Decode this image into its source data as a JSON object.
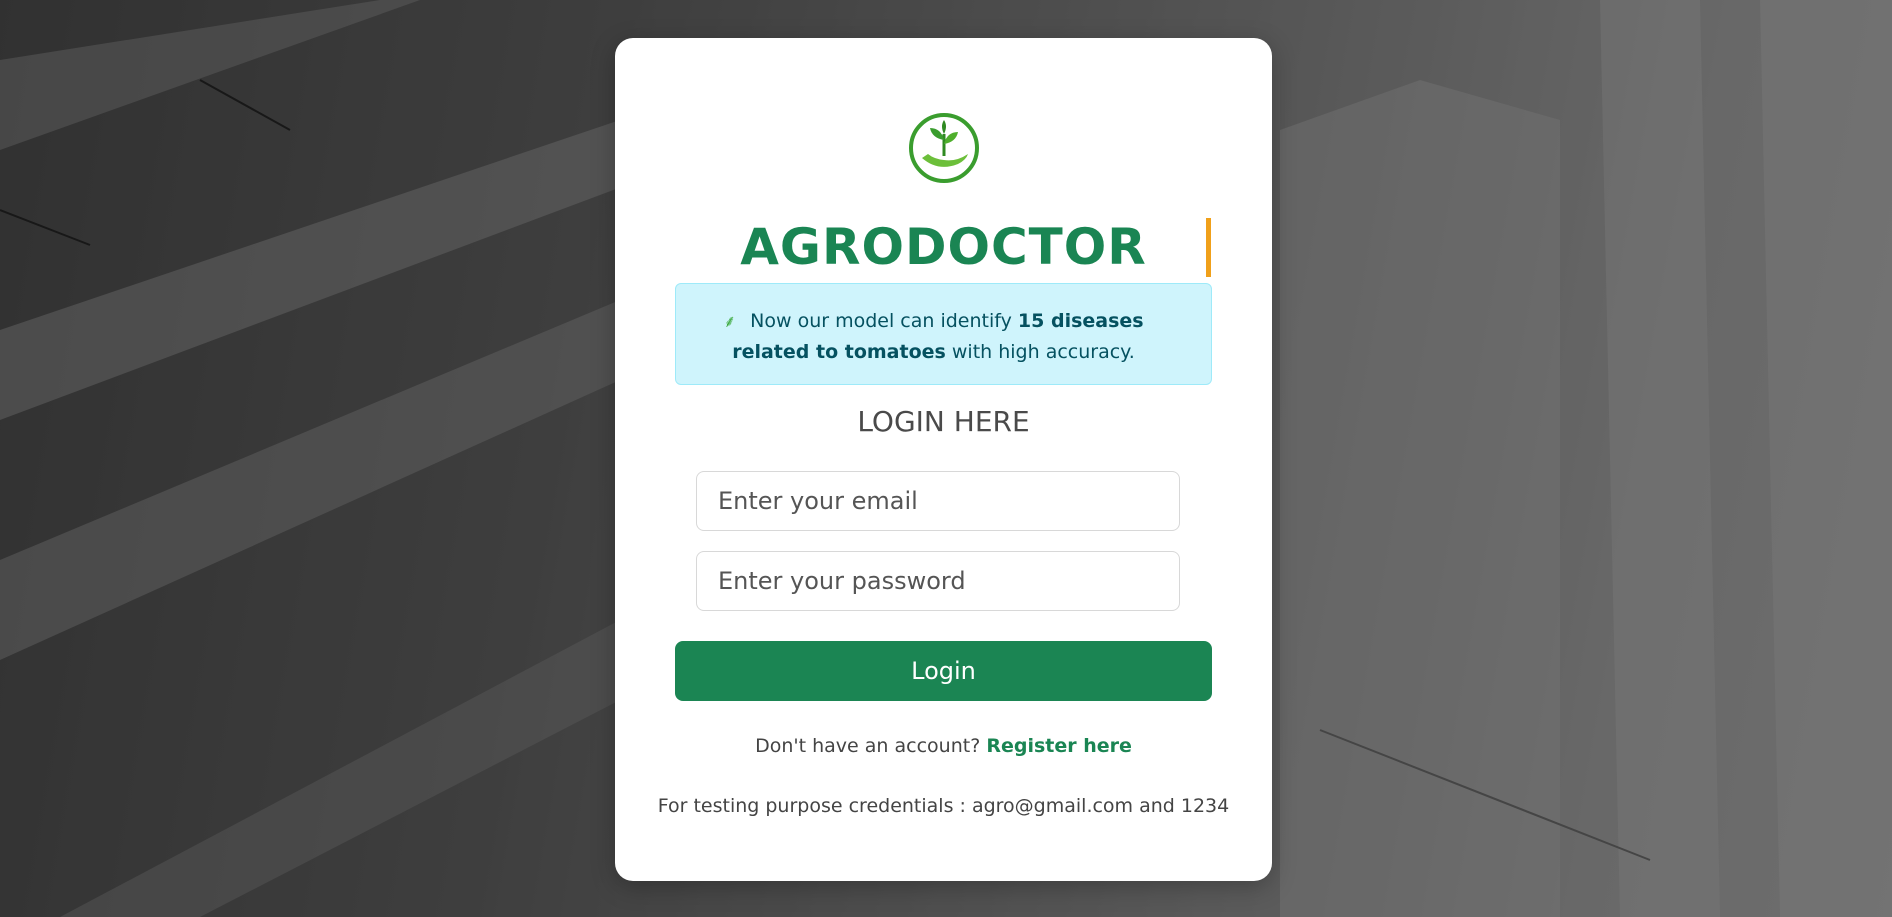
{
  "app": {
    "brand_name": "AGRODOCTOR",
    "logo_icon": "plant-in-hand-icon"
  },
  "notice": {
    "icon": "leaf-icon",
    "text_before": "Now our model can identify",
    "text_bold": "15 diseases related to tomatoes",
    "text_after": "with high accuracy."
  },
  "login": {
    "heading": "LOGIN HERE",
    "email_placeholder": "Enter your email",
    "email_value": "",
    "password_placeholder": "Enter your password",
    "password_value": "",
    "button_label": "Login"
  },
  "register": {
    "prompt": "Don't have an account?",
    "link_label": "Register here"
  },
  "footer": {
    "credentials_text": "For testing purpose credentials : agro@gmail.com and 1234"
  },
  "colors": {
    "brand_green": "#1a8553",
    "accent_orange": "#f0a01a",
    "notice_bg": "#cff4fc",
    "notice_text": "#055160"
  }
}
